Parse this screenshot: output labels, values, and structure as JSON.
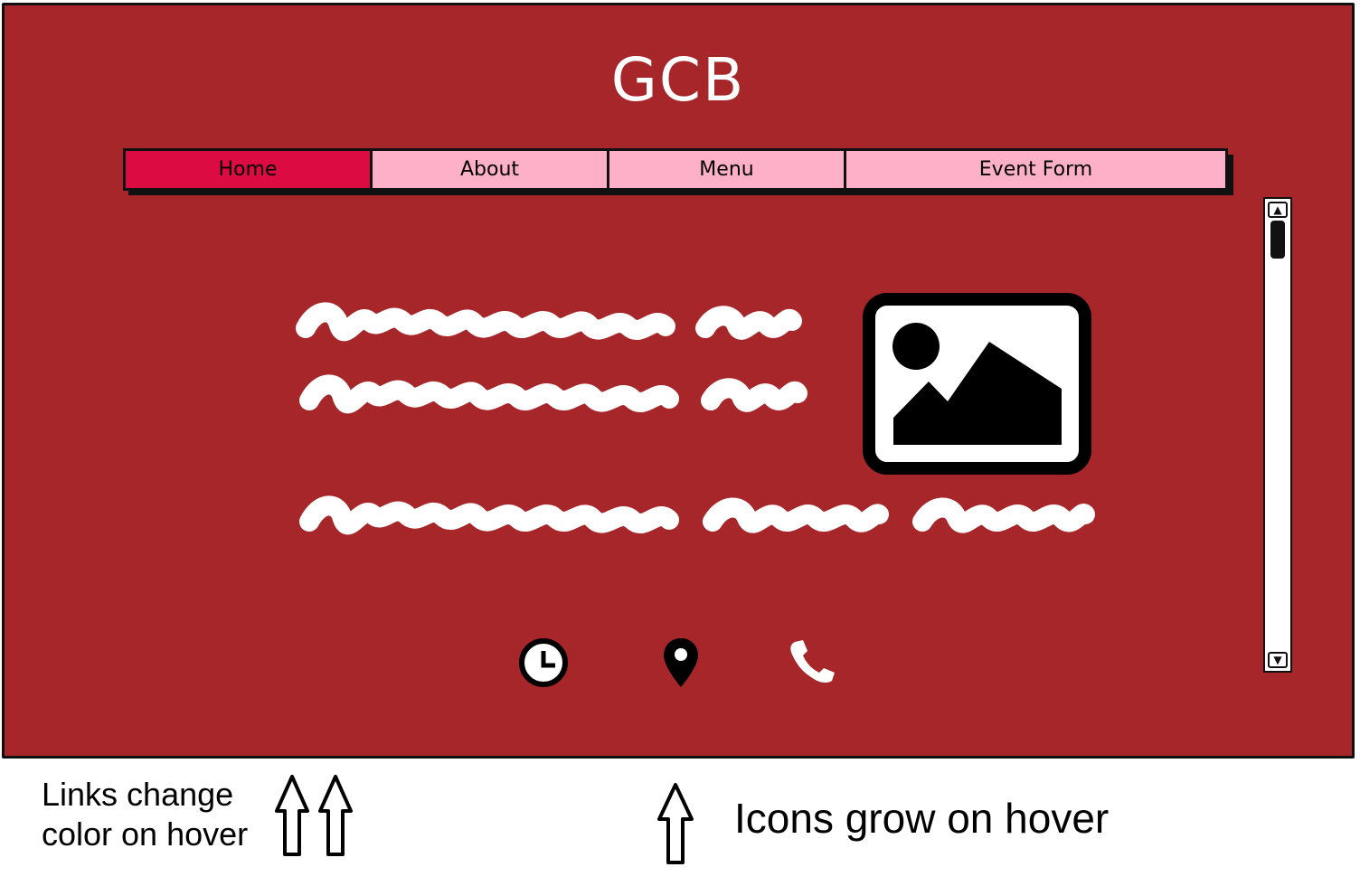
{
  "site": {
    "title": "GCB"
  },
  "nav": {
    "items": [
      {
        "label": "Home",
        "active": true
      },
      {
        "label": "About",
        "active": false
      },
      {
        "label": "Menu",
        "active": false
      },
      {
        "label": "Event Form",
        "active": false
      }
    ]
  },
  "content": {
    "text_lines": [
      "placeholder-scribble",
      "placeholder-scribble",
      "placeholder-scribble"
    ],
    "image": "image-placeholder-icon"
  },
  "contact_icons": [
    "clock-icon",
    "map-pin-icon",
    "phone-icon"
  ],
  "annotations": {
    "links_note_line1": "Links change",
    "links_note_line2": "color on hover",
    "icons_note": "Icons grow on hover"
  },
  "colors": {
    "background": "#a62629",
    "nav_active": "#dc0c42",
    "nav_default": "#feb0c8",
    "text_light": "#ffffff"
  }
}
